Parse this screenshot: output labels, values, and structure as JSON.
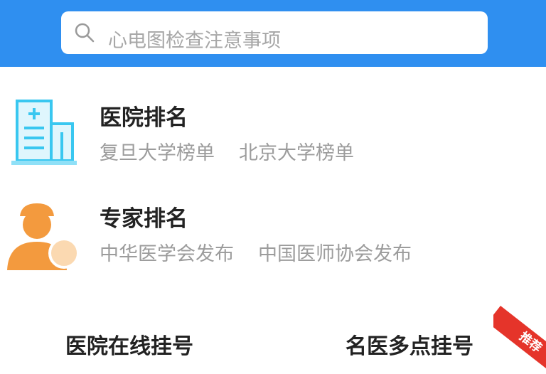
{
  "search": {
    "placeholder": "心电图检查注意事项"
  },
  "rankings": [
    {
      "title": "医院排名",
      "subtitles": [
        "复旦大学榜单",
        "北京大学榜单"
      ],
      "icon": "hospital-building-icon"
    },
    {
      "title": "专家排名",
      "subtitles": [
        "中华医学会发布",
        "中国医师协会发布"
      ],
      "icon": "doctor-avatar-icon"
    }
  ],
  "bottom": {
    "left_label": "医院在线挂号",
    "right_label": "名医多点挂号",
    "badge": "推荐"
  },
  "colors": {
    "header_blue": "#2f8ff0",
    "icon_cyan": "#39c7f0",
    "icon_orange": "#f39a3e",
    "badge_red": "#e5342a"
  }
}
